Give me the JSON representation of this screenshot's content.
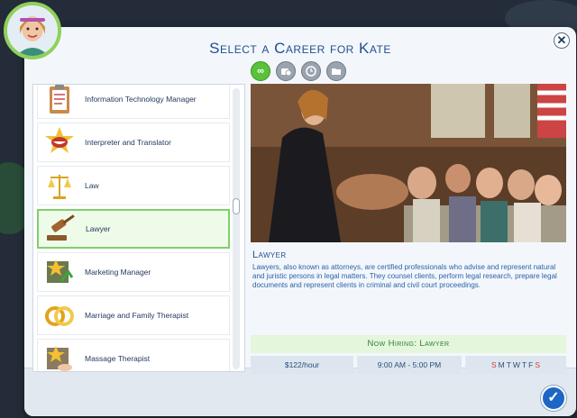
{
  "dialog": {
    "title": "Select a Career for Kate",
    "close_glyph": "✕",
    "accept_glyph": "✓"
  },
  "filters": [
    {
      "icon": "infinity-icon",
      "glyph": "∞",
      "active": true
    },
    {
      "icon": "part-time-icon",
      "glyph": "",
      "active": false
    },
    {
      "icon": "clock-icon",
      "glyph": "",
      "active": false
    },
    {
      "icon": "folder-icon",
      "glyph": "",
      "active": false
    }
  ],
  "careers": [
    {
      "label": "Information Technology Manager",
      "icon": "clipboard-icon"
    },
    {
      "label": "Interpreter and Translator",
      "icon": "speaking-mouth-icon"
    },
    {
      "label": "Law",
      "icon": "scales-icon"
    },
    {
      "label": "Lawyer",
      "icon": "gavel-icon",
      "selected": true
    },
    {
      "label": "Marketing Manager",
      "icon": "star-chart-icon"
    },
    {
      "label": "Marriage and Family Therapist",
      "icon": "rings-icon"
    },
    {
      "label": "Massage Therapist",
      "icon": "star-hands-icon"
    }
  ],
  "detail": {
    "name": "Lawyer",
    "description": "Lawyers, also known as attorneys, are certified professionals who advise and represent natural and juristic persons in legal matters. They counsel clients, perform legal research, prepare legal documents and represent clients in criminal and civil court proceedings.",
    "hiring": "Now Hiring: Lawyer",
    "pay": "$122/hour",
    "hours": "9:00 AM - 5:00 PM",
    "days": [
      {
        "d": "S",
        "work": false
      },
      {
        "d": "M",
        "work": true
      },
      {
        "d": "T",
        "work": true
      },
      {
        "d": "W",
        "work": true
      },
      {
        "d": "T",
        "work": true
      },
      {
        "d": "F",
        "work": true
      },
      {
        "d": "S",
        "work": false
      }
    ]
  },
  "colors": {
    "accent": "#1f4f8f",
    "selected": "#7fcf6a",
    "filter_active": "#59c23a"
  }
}
